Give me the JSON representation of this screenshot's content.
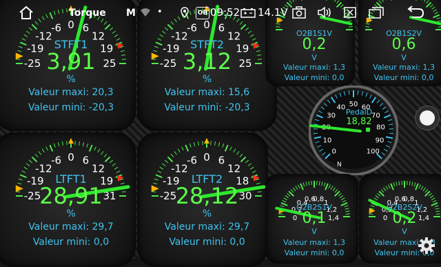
{
  "statusbar": {
    "title": "Torque",
    "time": "09:52",
    "battery_voltage": "14.1V",
    "gmail_letter": "M",
    "obd_badge": "OB",
    "dot": "•"
  },
  "gauges": {
    "stft1": {
      "name": "STFT1",
      "value": "3,91",
      "unit": "%",
      "ticks": [
        "-25",
        "-19",
        "-12",
        "-6",
        "0",
        "6",
        "12",
        "19",
        "25"
      ],
      "max_label": "Valeur maxi: 20,3",
      "min_label": "Valeur mini: -20,3",
      "needle_fraction": 0.58
    },
    "stft2": {
      "name": "STFT2",
      "value": "3,12",
      "unit": "%",
      "ticks": [
        "-25",
        "-19",
        "-12",
        "-6",
        "0",
        "6",
        "12",
        "19",
        "25"
      ],
      "max_label": "Valeur maxi: 15,6",
      "min_label": "Valeur mini: -20,3",
      "needle_fraction": 0.56
    },
    "ltft1": {
      "name": "LTFT1",
      "value": "28,91",
      "unit": "%",
      "ticks": [
        "-25",
        "-19",
        "-12",
        "-6",
        "0",
        "6",
        "12",
        "19",
        "31"
      ],
      "max_label": "Valeur maxi: 29,7",
      "min_label": "Valeur mini: 0,0",
      "needle_fraction": 0.95
    },
    "ltft2": {
      "name": "LTFT2",
      "value": "28,12",
      "unit": "%",
      "ticks": [
        "-25",
        "-19",
        "-12",
        "-6",
        "0",
        "6",
        "12",
        "18",
        "30"
      ],
      "max_label": "Valeur maxi: 29,7",
      "min_label": "Valeur mini: 0,0",
      "needle_fraction": 0.95
    },
    "o2b1s1": {
      "name": "O2B1S1V",
      "value": "0,2",
      "unit": "V",
      "max_label": "Valeur maxi: 1,3",
      "min_label": "Valeur mini: 0,0"
    },
    "o2b1s2": {
      "name": "O2B1S2V",
      "value": "0,6",
      "unit": "V",
      "max_label": "Valeur maxi: 1,3",
      "min_label": "Valeur mini: 0,0"
    },
    "pedal": {
      "name": "PedalD",
      "value": "18,82",
      "ticks": [
        "0",
        "10",
        "20",
        "30",
        "40",
        "50",
        "60",
        "70",
        "80",
        "90",
        "100"
      ],
      "needle_fraction": 0.19
    },
    "o2b2s1": {
      "name": "O2B2S1V",
      "value": "0,1",
      "unit": "V",
      "ticks": [
        "0",
        "0,2",
        "0,4",
        "0,6",
        "0,8",
        "1",
        "1,2",
        "1,4"
      ],
      "max_label": "Valeur maxi: 1,3",
      "min_label": "Valeur mini: 0,0",
      "needle_fraction": 0.07
    },
    "o2b2s2": {
      "name": "O2B2S2V",
      "value": "0,2",
      "unit": "V",
      "ticks": [
        "0",
        "0,2",
        "0,4",
        "0,6",
        "0,8",
        "1",
        "1,2",
        "1,4"
      ],
      "max_label": "Valeur maxi: 1,3",
      "min_label": "Valeur mini: 0,0",
      "needle_fraction": 0.14
    }
  },
  "colors": {
    "accent_green": "#5cff4a",
    "label_cyan": "#3fc4f0",
    "needle": "#2ee82e",
    "marker_yellow": "#ffb400",
    "marker_red": "#ff2a1a"
  },
  "icons": [
    "home-icon",
    "gmail-icon",
    "wifi-icon",
    "location-icon",
    "battery-icon",
    "camera-icon",
    "volume-icon",
    "close-box-icon",
    "window-icon",
    "back-icon",
    "settings-gear-icon"
  ]
}
